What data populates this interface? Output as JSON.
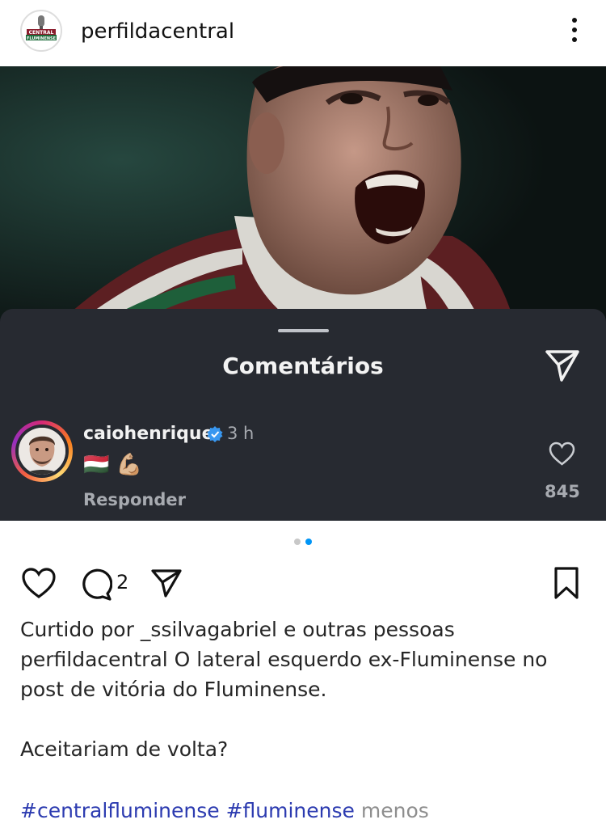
{
  "header": {
    "username": "perfildacentral",
    "avatar_text_top": "CENTRAL",
    "avatar_text_bottom": "FLUMINENSE",
    "more_icon": "more-vertical-icon"
  },
  "comments_sheet": {
    "title": "Comentários",
    "share_icon": "send-icon",
    "comment": {
      "username": "caiohenrique",
      "verified_icon": "verified-badge-icon",
      "time": "3 h",
      "text": "🇭🇺 💪🏼",
      "reply_label": "Responder",
      "like_icon": "heart-outline-icon",
      "like_count": "845"
    }
  },
  "carousel": {
    "total": 2,
    "active_index": 1,
    "active_color": "#0095f6",
    "inactive_color": "#c8c8c8"
  },
  "actions": {
    "like_icon": "heart-outline-icon",
    "comment_icon": "comment-bubble-icon",
    "comment_count": "2",
    "share_icon": "send-icon",
    "save_icon": "bookmark-icon"
  },
  "caption": {
    "liked_by": "Curtido por _ssilvagabriel e outras pessoas",
    "line1": "perfildacentral O lateral esquerdo ex-Fluminense no",
    "line2": "post de vitória do Fluminense.",
    "line3": "Aceitariam de volta?",
    "hashtag1": "#centralfluminense",
    "hashtag2": "#fluminense",
    "less_label": "menos",
    "hashtag_color": "#2c3bb0"
  }
}
